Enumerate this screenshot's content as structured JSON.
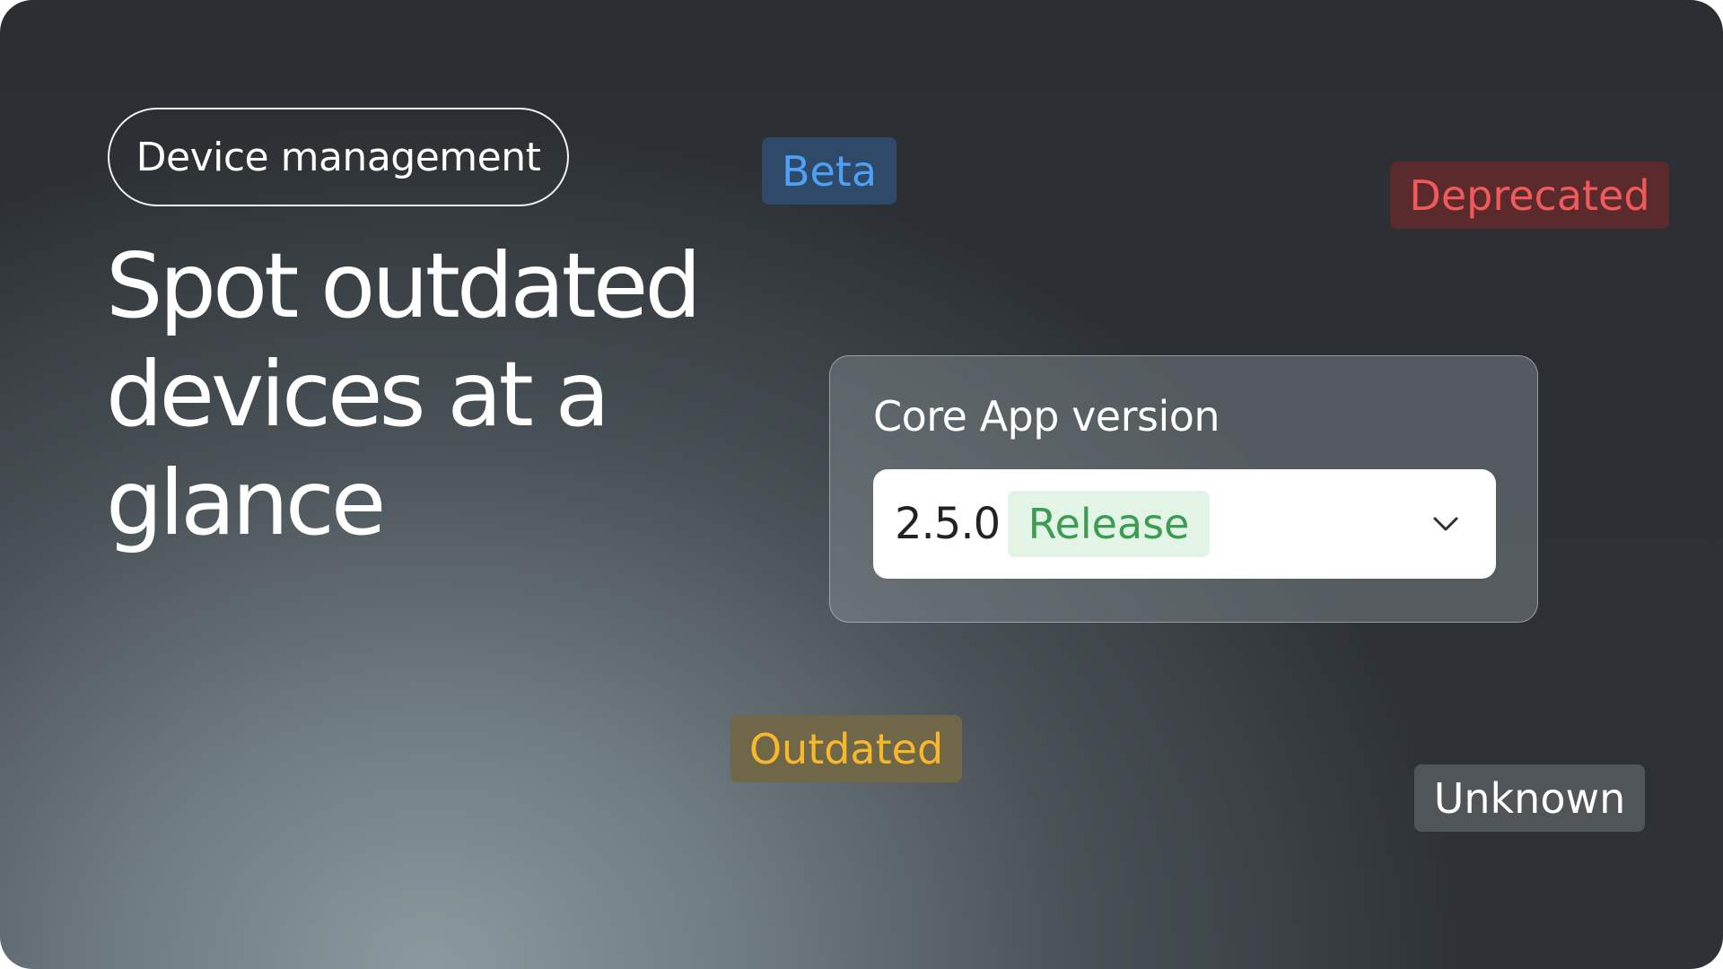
{
  "pill": {
    "label": "Device management"
  },
  "headline": {
    "text": "Spot outdated devices at a glance"
  },
  "tags": {
    "beta": "Beta",
    "deprecated": "Deprecated",
    "outdated": "Outdated",
    "unknown": "Unknown"
  },
  "version_card": {
    "label": "Core App version",
    "selected_value": "2.5.0",
    "selected_badge": "Release",
    "dropdown_icon": "chevron-down-icon"
  },
  "colors": {
    "beta": "#4da0f5",
    "deprecated": "#f05a5a",
    "outdated": "#f7b92b",
    "release": "#3d9b52"
  }
}
